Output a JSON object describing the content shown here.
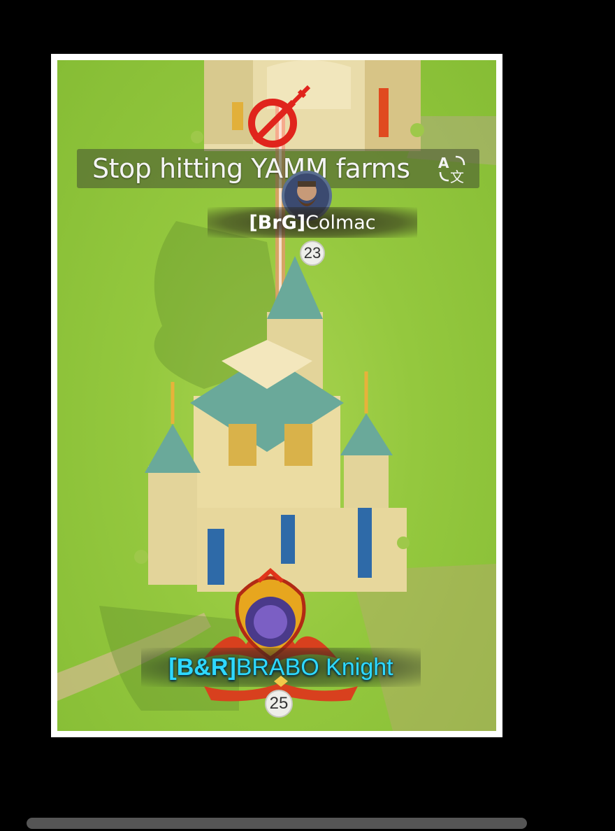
{
  "chat": {
    "message": "Stop hitting YAMM farms",
    "translate_icon": "translate-icon"
  },
  "player_top": {
    "alliance_tag": "[BrG]",
    "name": "Colmac",
    "level": "23",
    "avatar_icon": "bearded-warrior-avatar"
  },
  "player_bottom": {
    "alliance_tag": "[B&R]",
    "name": "BRABO Knight",
    "level": "25",
    "avatar_icon": "dragon-crest-avatar"
  },
  "status_icons": {
    "attack_forbidden": "sword-prohibited-icon"
  },
  "colors": {
    "grass": "#94c83e",
    "ally_name": "#2fd9ff",
    "attack_red": "#e0241c",
    "roof_teal": "#6aa99a"
  }
}
